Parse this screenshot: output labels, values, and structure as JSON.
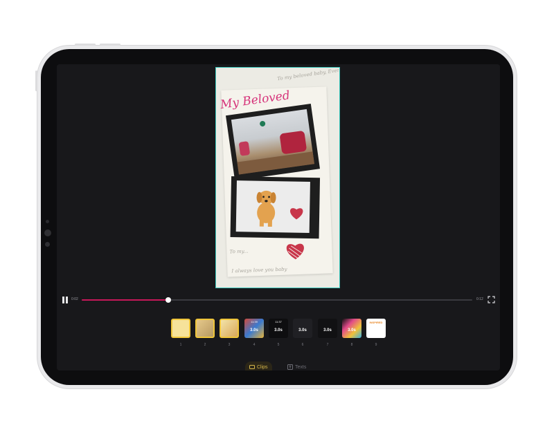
{
  "preview": {
    "title_text": "My Beloved",
    "top_note": "To my beloved baby, Even in our ending, forev",
    "bottom_note_1": "To my...",
    "bottom_note_2": "I always love you baby"
  },
  "playback": {
    "current_time": "0:02",
    "total_time": "0:12",
    "progress": 0.222
  },
  "clips": [
    {
      "number": "1",
      "duration": "",
      "top_text": "",
      "selected": true
    },
    {
      "number": "2",
      "duration": "",
      "top_text": "",
      "selected": true
    },
    {
      "number": "3",
      "duration": "",
      "top_text": "",
      "selected": true
    },
    {
      "number": "4",
      "duration": "3.0s",
      "top_text": "11:39",
      "selected": false
    },
    {
      "number": "5",
      "duration": "3.0s",
      "top_text": "11:37",
      "selected": false
    },
    {
      "number": "6",
      "duration": "3.0s",
      "top_text": "",
      "selected": false
    },
    {
      "number": "7",
      "duration": "3.0s",
      "top_text": "",
      "selected": false
    },
    {
      "number": "8",
      "duration": "3.0s",
      "top_text": "",
      "selected": false
    },
    {
      "number": "9",
      "duration": "",
      "top_text": "INSPIRED",
      "selected": false
    }
  ],
  "tabs": {
    "clips_label": "Clips",
    "texts_label": "Texts"
  },
  "colors": {
    "accent": "#c8185a",
    "selection": "#f0c63a",
    "preview_border": "#39c7bd"
  }
}
